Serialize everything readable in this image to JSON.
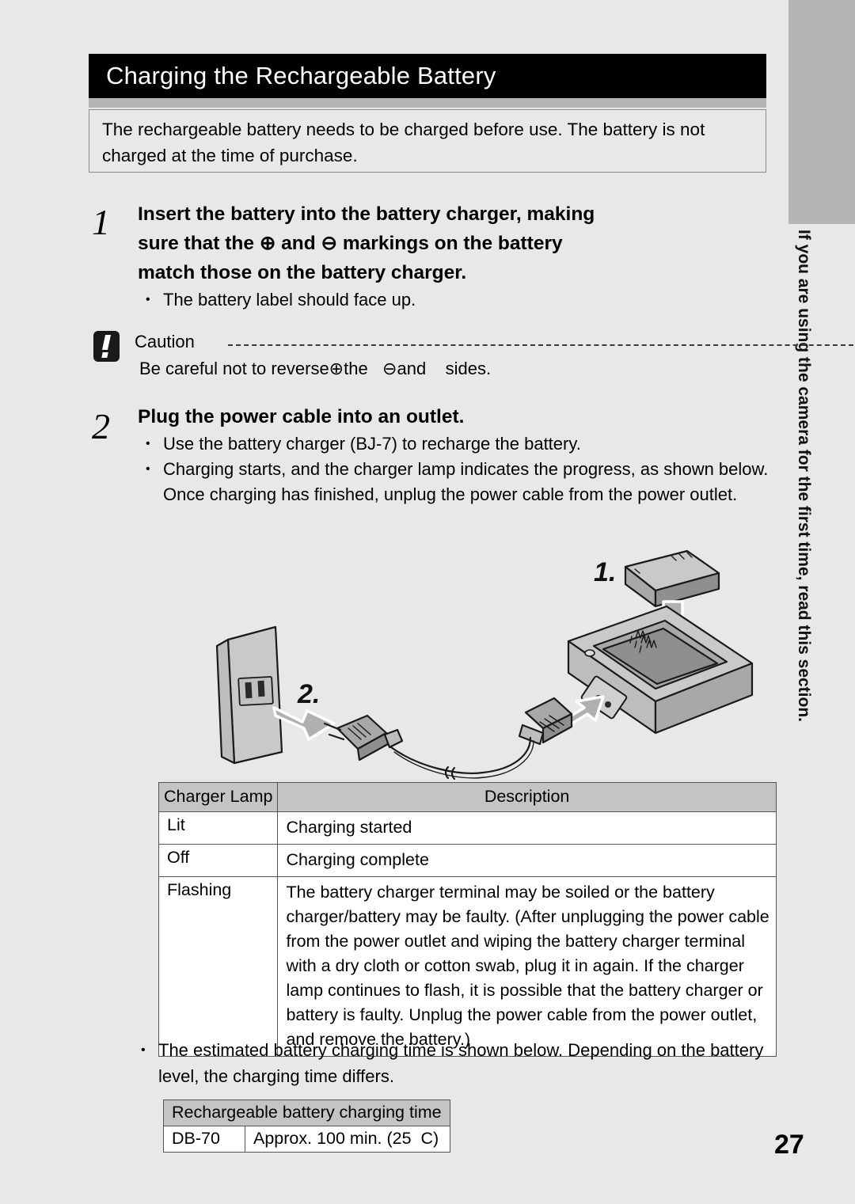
{
  "page": {
    "number": "27",
    "side_tab_label": "",
    "running_head": "If you are using the camera for the first time, read this section."
  },
  "header": {
    "title": "Charging the Rechargeable Battery"
  },
  "intro": {
    "text": "The rechargeable battery needs to be charged before use. The battery is not charged at the time of purchase."
  },
  "steps": [
    {
      "number": "1",
      "title_line1": "Insert the battery into the battery charger, making",
      "title_line2_a": "sure that the ",
      "title_plus": "⊕",
      "title_line2_b": " and ",
      "title_minus": "⊖",
      "title_line2_c": " markings on the battery",
      "title_line3": "match those on the battery charger.",
      "bullets": [
        "The battery label should face up."
      ]
    },
    {
      "number": "2",
      "title_line1": "Plug the power cable into an outlet.",
      "bullets": [
        "Use the battery charger (BJ-7) to recharge the battery.",
        "Charging starts, and the charger lamp indicates the progress, as shown below. Once charging has finished, unplug the power cable from the power outlet."
      ]
    }
  ],
  "caution": {
    "label": "Caution",
    "text": "Be careful not to reverse⊕the   ⊖and    sides."
  },
  "figure": {
    "callout_1": "1.",
    "callout_2": "2.",
    "parts": [
      "battery-pack",
      "battery-charger",
      "power-cable",
      "wall-outlet"
    ]
  },
  "lamp_table": {
    "headers": [
      "Charger Lamp",
      "Description"
    ],
    "rows": [
      {
        "lamp": "Lit",
        "description_lines": [
          "Charging started"
        ]
      },
      {
        "lamp": "Off",
        "description_lines": [
          "Charging complete"
        ]
      },
      {
        "lamp": "Flashing",
        "description_lines": [
          "The battery charger terminal may be soiled or the battery",
          "charger/battery may be faulty. (After unplugging the power cable",
          "from the power outlet and wiping the battery charger terminal",
          "with a dry cloth or cotton swab, plug it in again. If the charger",
          "lamp continues to flash, it is possible that the battery charger or",
          "battery is faulty. Unplug the power cable from the power outlet,",
          "and remove the battery.)"
        ]
      }
    ]
  },
  "tail_bullet": {
    "text": "The estimated battery charging time is shown below. Depending on the battery level, the charging time differs."
  },
  "time_table": {
    "header": "Rechargeable battery charging time",
    "model": "DB-70",
    "value": "Approx. 100 min. (25  C)"
  },
  "colors": {
    "page_bg": "#e8e8e8",
    "banner_bg": "#000000",
    "banner_text": "#ffffff",
    "gray_bar": "#b5b5b5",
    "table_header_bg": "#c4c4c4",
    "cell_bg": "#ffffff",
    "rule": "#555555"
  }
}
